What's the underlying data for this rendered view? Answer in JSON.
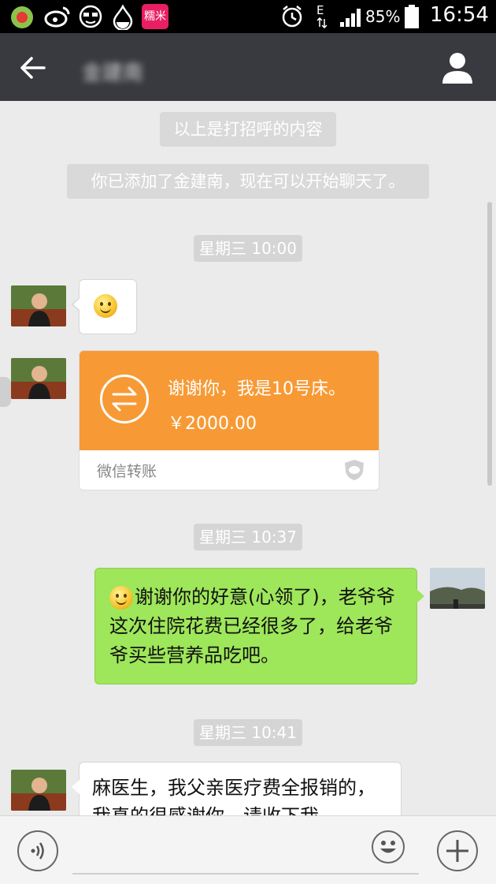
{
  "status_bar": {
    "battery": "85%",
    "time": "16:54",
    "network": "E",
    "app_icons": [
      "app-icon",
      "weibo-icon",
      "sunglasses-icon",
      "drop-icon",
      "nuomi-icon"
    ],
    "nuomi_label": "糯米"
  },
  "header": {
    "title": "金建南"
  },
  "messages": {
    "system_greeting": "以上是打招呼的内容",
    "system_added": "你已添加了金建南，现在可以开始聊天了。",
    "time_1": "星期三 10:00",
    "transfer_message": "谢谢你，我是10号床。",
    "transfer_amount": "￥2000.00",
    "transfer_label": "微信转账",
    "time_2": "星期三 10:37",
    "reply_text": "谢谢你的好意(心领了)，老爷爷这次住院花费已经很多了，给老爷爷买些营养品吃吧。",
    "time_3": "星期三 10:41",
    "last_message": "麻医生，我父亲医疗费全报销的，我真的很感谢你，请收下我"
  },
  "colors": {
    "titlebar": "#393a3f",
    "transfer": "#f79a35",
    "outgoing_bubble": "#9ee65a",
    "chat_bg": "#ebebeb"
  }
}
